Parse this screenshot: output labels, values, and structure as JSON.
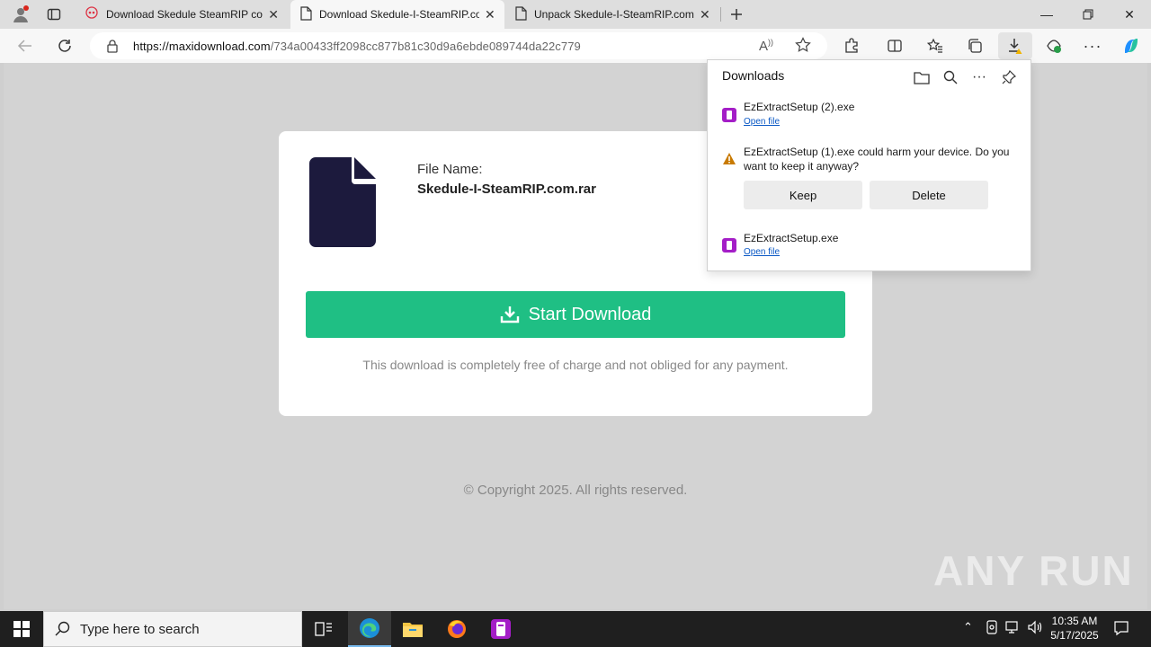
{
  "tabs": [
    {
      "title": "Download Skedule SteamRIP com",
      "active": false
    },
    {
      "title": "Download Skedule-I-SteamRIP.com",
      "active": true
    },
    {
      "title": "Unpack Skedule-I-SteamRIP.com",
      "active": false
    }
  ],
  "address_bar": {
    "url_domain": "https://maxidownload.com",
    "url_path": "/734a00433ff2098cc877b81c30d9a6ebde089744da22c779"
  },
  "page": {
    "file_label": "File Name:",
    "file_name": "Skedule-I-SteamRIP.com.rar",
    "download_button": "Start Download",
    "note": "This download is completely free of charge and not obliged for any payment.",
    "copyright": "© Copyright 2025. All rights reserved."
  },
  "downloads_panel": {
    "title": "Downloads",
    "items": [
      {
        "name": "EzExtractSetup (2).exe",
        "link": "Open file"
      },
      {
        "warning": "EzExtractSetup (1).exe could harm your device. Do you want to keep it anyway?",
        "keep": "Keep",
        "delete": "Delete"
      },
      {
        "name": "EzExtractSetup.exe",
        "link": "Open file"
      }
    ]
  },
  "taskbar": {
    "search_placeholder": "Type here to search",
    "time": "10:35 AM",
    "date": "5/17/2025"
  },
  "watermark": "ANY RUN",
  "colors": {
    "download_button": "#1fbf84",
    "file_icon": "#1c1a3d",
    "link": "#0a58c5"
  }
}
